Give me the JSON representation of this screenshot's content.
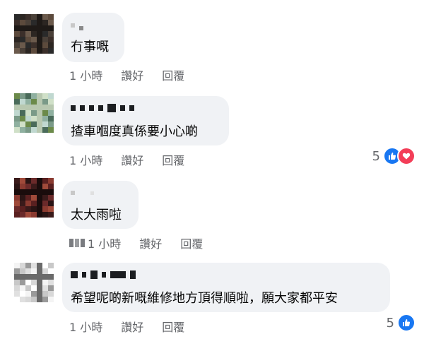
{
  "comments": [
    {
      "text": "冇事嘅",
      "meta": {
        "time": "1 小時",
        "like": "讚好",
        "reply": "回覆"
      },
      "reaction_count": "",
      "avatar_colors": [
        "#2a2a2a",
        "#4a4038",
        "#5c4a3c",
        "#3b2f2a",
        "#6b5a4c",
        "#2c2622",
        "#1f1a17"
      ]
    },
    {
      "text": "揸車嗰度真係要小心啲",
      "meta": {
        "time": "1 小時",
        "like": "讚好",
        "reply": "回覆"
      },
      "reaction_count": "5",
      "reactions": [
        "like-icon",
        "love-icon"
      ],
      "avatar_colors": [
        "#6b8a4a",
        "#8fb0a0",
        "#c0d8d0",
        "#4a6b5a",
        "#d0e0c8",
        "#7a9a88",
        "#b8c8b0"
      ]
    },
    {
      "text": "太大雨啦",
      "meta": {
        "time": "1 小時",
        "like": "讚好",
        "reply": "回覆"
      },
      "reaction_count": "",
      "avatar_colors": [
        "#3a1a1a",
        "#6a2a2a",
        "#8a3a30",
        "#2a1414",
        "#5a2020",
        "#a04a3a",
        "#1a0c0c"
      ]
    },
    {
      "text": "希望呢啲新嘅維修地方頂得順啦，願大家都平安",
      "meta": {
        "time": "1 小時",
        "like": "讚好",
        "reply": "回覆"
      },
      "reaction_count": "5",
      "reactions": [
        "like-icon"
      ],
      "avatar_colors": [
        "#f4f4f4",
        "#e0e0e0",
        "#c8c8c8",
        "#9a9a9a",
        "#ffffff",
        "#d8d8d8",
        "#6a6a6a"
      ]
    }
  ],
  "colors": {
    "bubble": "#f0f2f5",
    "meta": "#65676b",
    "like": "#1877f2",
    "love": "#f33e58"
  }
}
